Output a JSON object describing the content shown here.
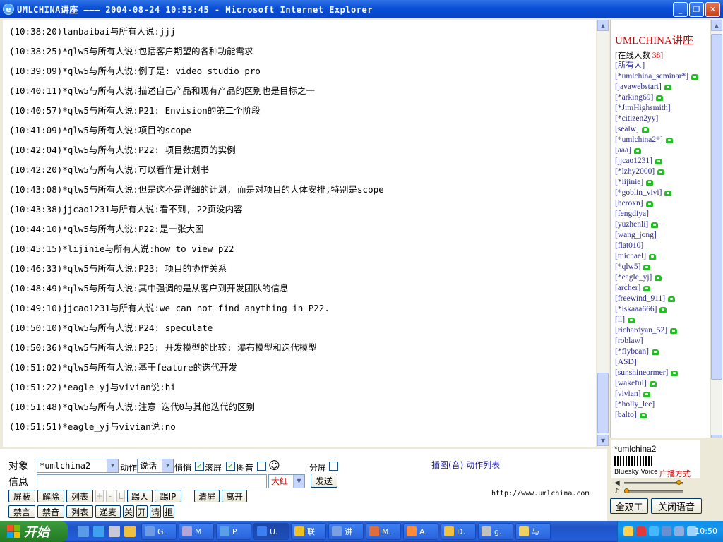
{
  "window": {
    "title": "UMLCHINA讲座 ——— 2004-08-24 10:55:45 - Microsoft Internet Explorer",
    "minimize": "_",
    "maximize": "❐",
    "close": "✕"
  },
  "chat": {
    "lines": [
      {
        "time": "(10:38:20)",
        "user": "lanbaibai",
        "to": "与所有人说:",
        "msg": "jjj"
      },
      {
        "time": "(10:38:25)",
        "user": "*qlw5",
        "to": "与所有人说:",
        "msg": "包括客户期望的各种功能需求"
      },
      {
        "time": "(10:39:09)",
        "user": "*qlw5",
        "to": "与所有人说:",
        "msg": "例子是: video studio pro"
      },
      {
        "time": "(10:40:11)",
        "user": "*qlw5",
        "to": "与所有人说:",
        "msg": "描述自己产品和现有产品的区别也是目标之一"
      },
      {
        "time": "(10:40:57)",
        "user": "*qlw5",
        "to": "与所有人说:",
        "msg": "P21: Envision的第二个阶段"
      },
      {
        "time": "(10:41:09)",
        "user": "*qlw5",
        "to": "与所有人说:",
        "msg": "项目的scope"
      },
      {
        "time": "(10:42:04)",
        "user": "*qlw5",
        "to": "与所有人说:",
        "msg": "P22: 项目数据页的实例"
      },
      {
        "time": "(10:42:20)",
        "user": "*qlw5",
        "to": "与所有人说:",
        "msg": "可以看作是计划书"
      },
      {
        "time": "(10:43:08)",
        "user": "*qlw5",
        "to": "与所有人说:",
        "msg": "但是这不是详细的计划, 而是对项目的大体安排,特别是scope"
      },
      {
        "time": "(10:43:38)",
        "user": "jjcao1231",
        "to": "与所有人说:",
        "msg": "看不到, 22页没内容"
      },
      {
        "time": "(10:44:10)",
        "user": "*qlw5",
        "to": "与所有人说:",
        "msg": "P22:是一张大图"
      },
      {
        "time": "(10:45:15)",
        "user": "*lijinie",
        "to": "与所有人说:",
        "msg": "how to view p22"
      },
      {
        "time": "(10:46:33)",
        "user": "*qlw5",
        "to": "与所有人说:",
        "msg": "P23: 项目的协作关系"
      },
      {
        "time": "(10:48:49)",
        "user": "*qlw5",
        "to": "与所有人说:",
        "msg": "其中强调的是从客户到开发团队的信息"
      },
      {
        "time": "(10:49:10)",
        "user": "jjcao1231",
        "to": "与所有人说:",
        "msg": "we can not find anything in P22."
      },
      {
        "time": "(10:50:10)",
        "user": "*qlw5",
        "to": "与所有人说:",
        "msg": "P24: speculate"
      },
      {
        "time": "(10:50:36)",
        "user": "*qlw5",
        "to": "与所有人说:",
        "msg": "P25: 开发模型的比较: 瀑布模型和迭代模型"
      },
      {
        "time": "(10:51:02)",
        "user": "*qlw5",
        "to": "与所有人说:",
        "msg": "基于feature的迭代开发"
      },
      {
        "time": "(10:51:22)",
        "user": "*eagle_yj",
        "to": "与vivian说:",
        "msg": "hi"
      },
      {
        "time": "(10:51:48)",
        "user": "*qlw5",
        "to": "与所有人说:",
        "msg": "注意 迭代0与其他迭代的区别"
      },
      {
        "time": "(10:51:51)",
        "user": "*eagle_yj",
        "to": "与vivian说:",
        "msg": "no"
      }
    ]
  },
  "userlist": {
    "title": "UMLCHINA讲座",
    "online_label": "[在线人数 ",
    "online_count": "38",
    "online_close": "]",
    "users": [
      {
        "name": "[所有人]",
        "phone": false
      },
      {
        "name": "[*umlchina_seminar*]",
        "phone": true
      },
      {
        "name": "[javawebstart]",
        "phone": true
      },
      {
        "name": "[*arking69]",
        "phone": true
      },
      {
        "name": "[*JimHighsmith]",
        "phone": false
      },
      {
        "name": "[*citizen2yy]",
        "phone": false
      },
      {
        "name": "[sealw]",
        "phone": true
      },
      {
        "name": "[*umlchina2*]",
        "phone": true
      },
      {
        "name": "[aaa]",
        "phone": true
      },
      {
        "name": "[jjcao1231]",
        "phone": true
      },
      {
        "name": "[*lzhy2000]",
        "phone": true
      },
      {
        "name": "[*lijinie]",
        "phone": true
      },
      {
        "name": "[*goblin_vivi]",
        "phone": true
      },
      {
        "name": "[heroxn]",
        "phone": true
      },
      {
        "name": "[fengdiya]",
        "phone": false
      },
      {
        "name": "[yuzhenli]",
        "phone": true
      },
      {
        "name": "[wang_jong]",
        "phone": false
      },
      {
        "name": "[flat010]",
        "phone": false
      },
      {
        "name": "[michael]",
        "phone": true
      },
      {
        "name": "[*qlw5]",
        "phone": true
      },
      {
        "name": "[*eagle_yj]",
        "phone": true
      },
      {
        "name": "[archer]",
        "phone": true
      },
      {
        "name": "[freewind_911]",
        "phone": true
      },
      {
        "name": "[*lskaaa666]",
        "phone": true
      },
      {
        "name": "[ll]",
        "phone": true
      },
      {
        "name": "[richardyan_52]",
        "phone": true
      },
      {
        "name": "[roblaw]",
        "phone": false
      },
      {
        "name": "[*flybean]",
        "phone": true
      },
      {
        "name": "[ASD]",
        "phone": false
      },
      {
        "name": "[sunshineormer]",
        "phone": true
      },
      {
        "name": "[wakeful]",
        "phone": true
      },
      {
        "name": "[vivian]",
        "phone": true
      },
      {
        "name": "[*holly_lee]",
        "phone": false
      },
      {
        "name": "[balto]",
        "phone": true
      }
    ]
  },
  "controls": {
    "target_label": "对象",
    "target_value": "*umlchina2",
    "action_label": "动作",
    "action_value": "说话",
    "whisper_label": "悄悄",
    "scroll_label": "滚屏",
    "image_label": "图音",
    "split_label": "分屏",
    "insert_link": "插图(音) 动作列表",
    "message_label": "信息",
    "message_value": "",
    "color_value": "大红",
    "send_button": "发送",
    "buttons_row1": [
      "屏蔽",
      "解除",
      "列表",
      "+",
      "-",
      "L",
      "踢人",
      "踢IP",
      "清屏",
      "离开"
    ],
    "buttons_row2": [
      "禁言",
      "禁音",
      "列表",
      "递麦",
      "关",
      "开",
      "请",
      "拒"
    ],
    "url": "http://www.umlchina.com"
  },
  "voice": {
    "current_user": "*umlchina2",
    "brand": "Bluesky Voice",
    "mode": "广播方式",
    "duplex_button": "全双工",
    "close_voice_button": "关闭语音"
  },
  "taskbar": {
    "start": "开始",
    "tasks": [
      "G.",
      "M.",
      "P.",
      "U.",
      "联",
      "讲",
      "M.",
      "A.",
      "D.",
      "g.",
      "与"
    ],
    "clock": "10:50"
  },
  "colors": {
    "accent_red": "#d40000",
    "phone_green": "#23c023",
    "titlebar_blue": "#0a4fd6"
  }
}
